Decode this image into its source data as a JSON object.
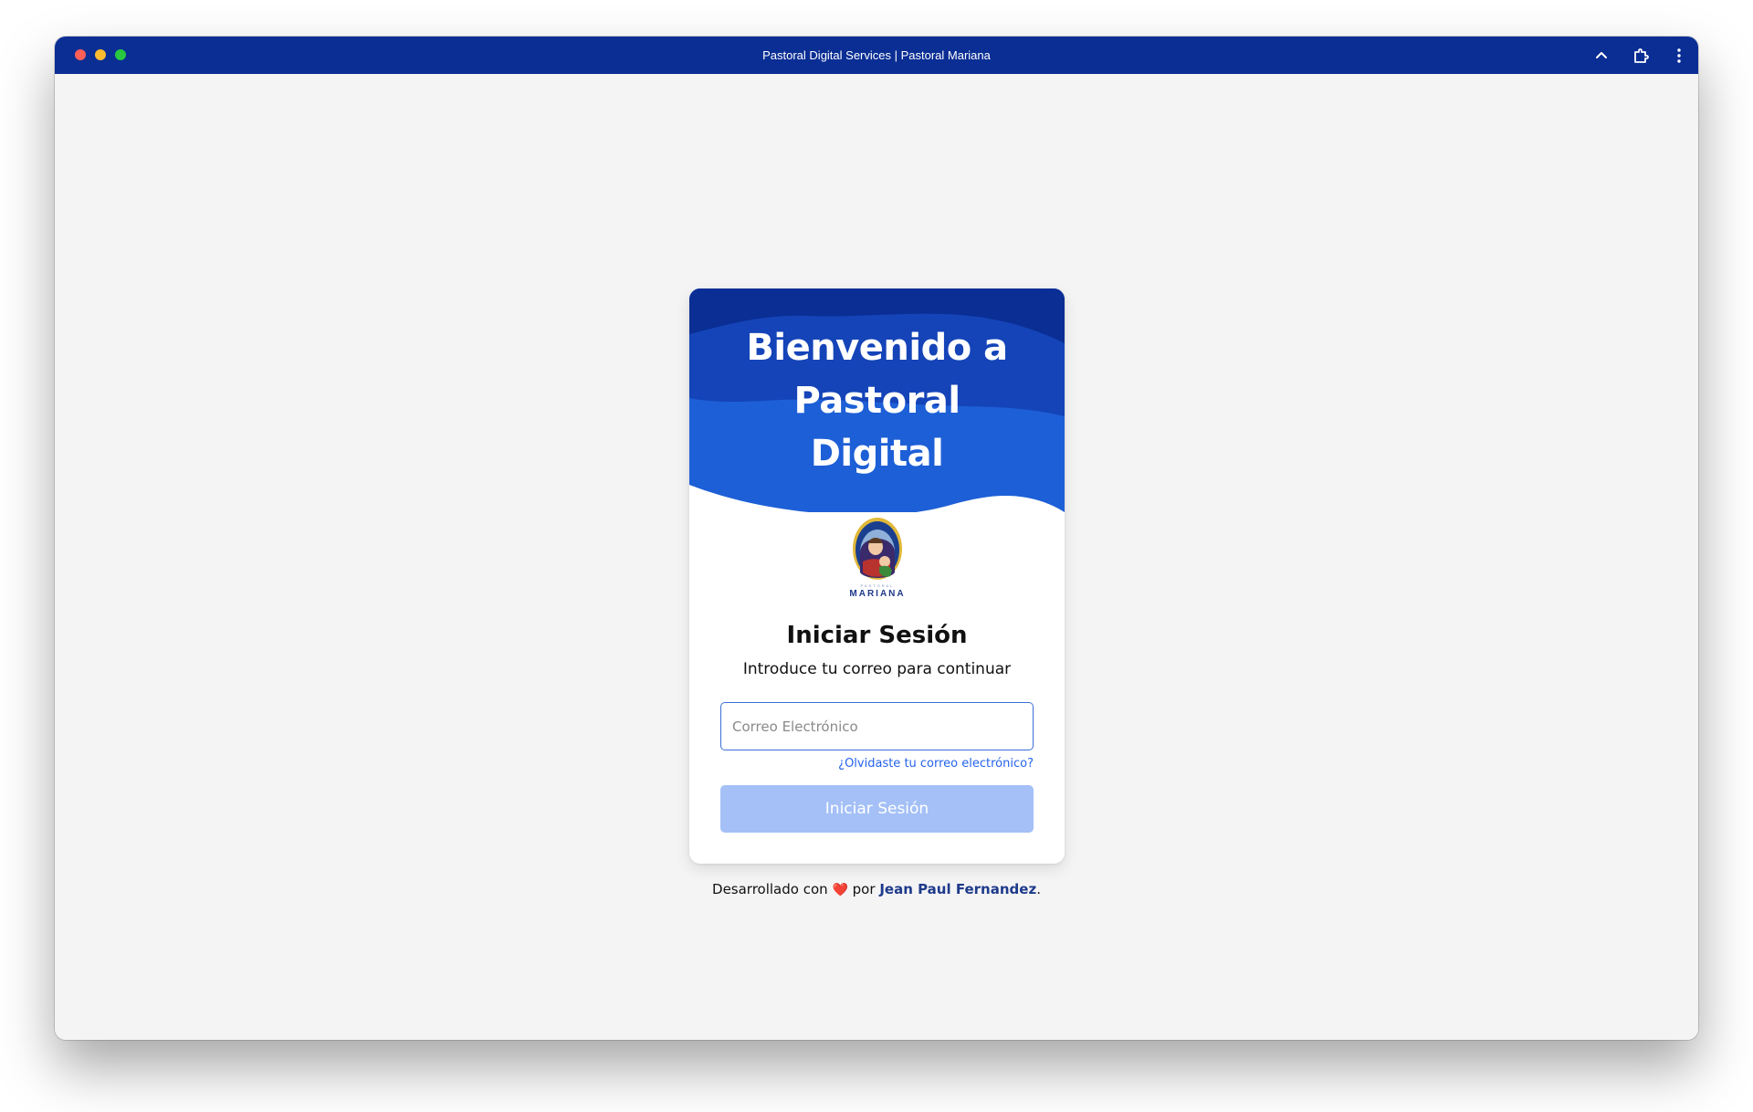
{
  "window": {
    "title": "Pastoral Digital Services | Pastoral Mariana",
    "titlebar_color": "#0a2e94",
    "icons": [
      "chevron-up-icon",
      "extension-puzzle-icon",
      "more-vertical-icon"
    ]
  },
  "card": {
    "hero_title": "Bienvenido a Pastoral Digital",
    "hero_colors": [
      "#0a2e94",
      "#1444b8",
      "#1d5fd6"
    ],
    "logo": {
      "name": "MARIANA",
      "subname": "PASTORAL"
    },
    "login_title": "Iniciar Sesión",
    "login_subtitle": "Introduce tu correo para continuar",
    "email": {
      "placeholder": "Correo Electrónico",
      "value": ""
    },
    "forgot_link": "¿Olvidaste tu correo electrónico?",
    "submit_label": "Iniciar Sesión",
    "submit_color": "#a4c0f7"
  },
  "footer": {
    "prefix": "Desarrollado con",
    "heart": "❤️",
    "middle": "por",
    "author": "Jean Paul Fernandez",
    "suffix": "."
  }
}
